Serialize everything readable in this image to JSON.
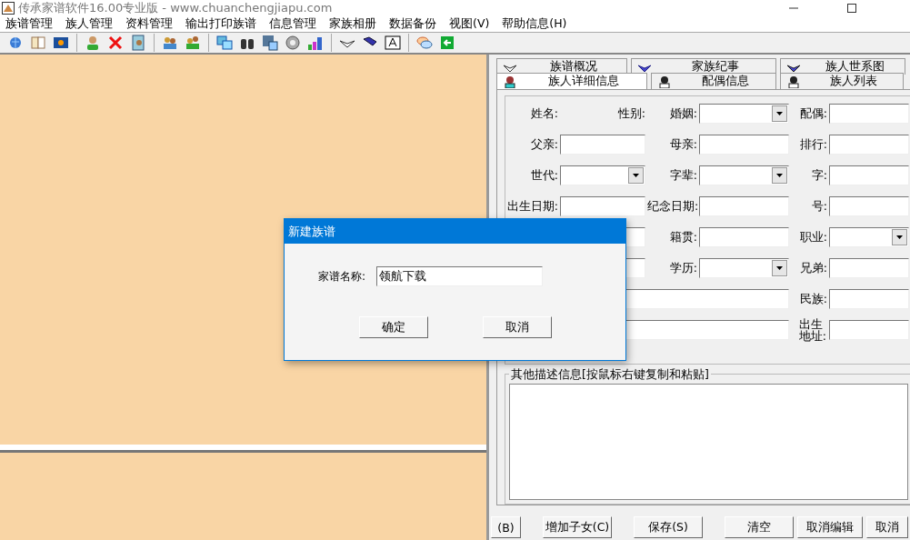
{
  "window": {
    "title": "传承家谱软件16.00专业版 - www.chuanchengjiapu.com"
  },
  "menu": [
    "族谱管理",
    "族人管理",
    "资料管理",
    "输出打印族谱",
    "信息管理",
    "家族相册",
    "数据备份",
    "视图(V)",
    "帮助信息(H)"
  ],
  "tabs": [
    [
      {
        "label": "族谱概况",
        "selected": false
      },
      {
        "label": "家族纪事",
        "selected": false
      },
      {
        "label": "族人世系图",
        "selected": false
      }
    ],
    [
      {
        "label": "族人详细信息",
        "selected": true
      },
      {
        "label": "配偶信息",
        "selected": false
      },
      {
        "label": "族人列表",
        "selected": false
      }
    ]
  ],
  "form": [
    {
      "label_1": "姓名:",
      "field_1": {
        "kind": "caption",
        "text": "性别:"
      },
      "label_2": "婚姻:",
      "field_2": {
        "kind": "combo"
      },
      "label_3": "配偶:",
      "field_3": {
        "kind": "text"
      }
    },
    {
      "label_1": "父亲:",
      "field_1": {
        "kind": "text"
      },
      "label_2": "母亲:",
      "field_2": {
        "kind": "text"
      },
      "label_3": "排行:",
      "field_3": {
        "kind": "text"
      }
    },
    {
      "label_1": "世代:",
      "field_1": {
        "kind": "combo"
      },
      "label_2": "字辈:",
      "field_2": {
        "kind": "combo"
      },
      "label_3": "字:",
      "field_3": {
        "kind": "text"
      }
    },
    {
      "label_1": "出生日期:",
      "field_1": {
        "kind": "text"
      },
      "label_2": "纪念日期:",
      "field_2": {
        "kind": "text"
      },
      "label_3": "号:",
      "field_3": {
        "kind": "text"
      }
    },
    {
      "field_1": {
        "kind": "text"
      },
      "label_2": "籍贯:",
      "field_2": {
        "kind": "text"
      },
      "label_3": "职业:",
      "field_3": {
        "kind": "combo"
      }
    },
    {
      "field_1": {
        "kind": "text"
      },
      "label_2": "学历:",
      "field_2": {
        "kind": "combo"
      },
      "label_3": "兄弟:",
      "field_3": {
        "kind": "text"
      }
    },
    {
      "field_1": {
        "kind": "wide"
      },
      "label_3": "民族:",
      "field_3": {
        "kind": "text"
      }
    },
    {
      "field_1": {
        "kind": "wide"
      },
      "label_3": "出生地址:",
      "field_3": {
        "kind": "text"
      }
    }
  ],
  "notes": {
    "title": "其他描述信息[按鼠标右键复制和粘贴]"
  },
  "buttons": [
    "(B)",
    "增加子女(C)",
    "保存(S)",
    "清空",
    "取消编辑",
    "取消"
  ],
  "dialog": {
    "title": "新建族谱",
    "label": "家谱名称:",
    "value": "领航下载",
    "buttons": [
      "确定",
      "取消"
    ]
  }
}
